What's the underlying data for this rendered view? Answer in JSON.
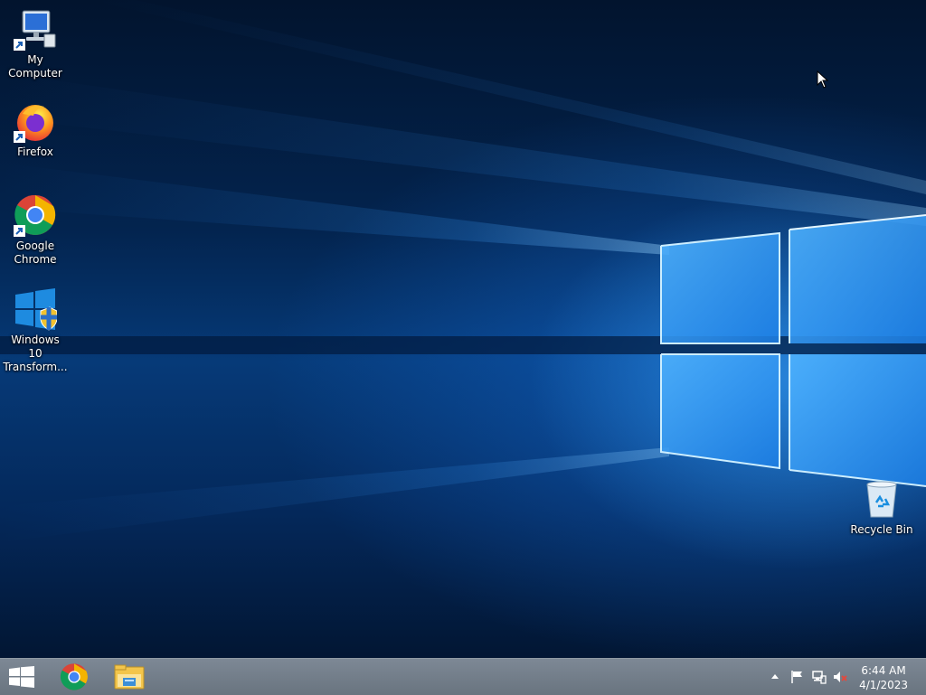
{
  "desktop": {
    "icons": [
      {
        "label": "My Computer"
      },
      {
        "label": "Firefox"
      },
      {
        "label": "Google Chrome"
      },
      {
        "label": "Windows 10 Transform..."
      }
    ],
    "recycle_bin": {
      "label": "Recycle Bin"
    }
  },
  "taskbar": {
    "start_icon": "windows-logo-icon",
    "pinned": [
      "chrome-icon",
      "file-explorer-icon"
    ],
    "tray": {
      "icons": [
        "show-hidden-icons-arrow",
        "action-center-flag-icon",
        "network-icon",
        "volume-muted-icon"
      ]
    },
    "clock": {
      "time": "6:44 AM",
      "date": "4/1/2023"
    }
  },
  "colors": {
    "taskbar": "#6f7a85",
    "wallpaper_blue": "#0a5bbf",
    "accent": "#0078d7"
  }
}
